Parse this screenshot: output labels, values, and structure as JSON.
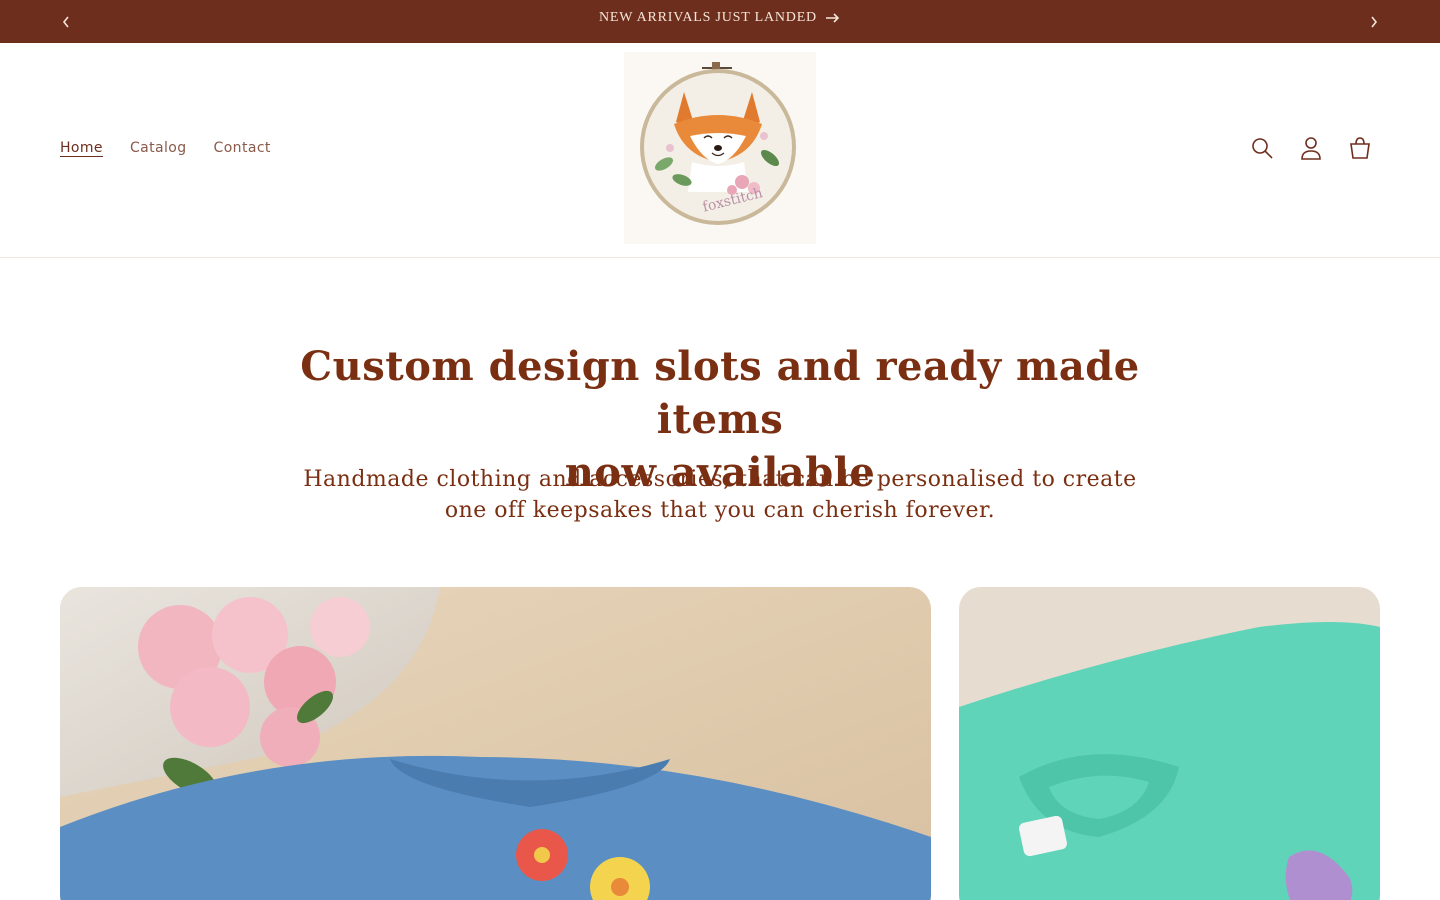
{
  "announcement": {
    "text": "NEW ARRIVALS JUST LANDED",
    "prev_icon": "chevron-left-icon",
    "next_icon": "chevron-right-icon",
    "arrow_icon": "arrow-right-icon"
  },
  "header": {
    "nav": [
      {
        "label": "Home",
        "active": true
      },
      {
        "label": "Catalog",
        "active": false
      },
      {
        "label": "Contact",
        "active": false
      }
    ],
    "logo_text": "foxstitch",
    "icons": [
      "search-icon",
      "account-icon",
      "cart-icon"
    ]
  },
  "hero": {
    "title_line1": "Custom design slots and ready made items",
    "title_line2": "now available",
    "subtitle_line1": "Handmade clothing and accessories, that can be personalised to create",
    "subtitle_line2": "one off keepsakes that you can cherish forever."
  },
  "colors": {
    "brand": "#6e2e1e",
    "heading": "#7a2f12"
  }
}
